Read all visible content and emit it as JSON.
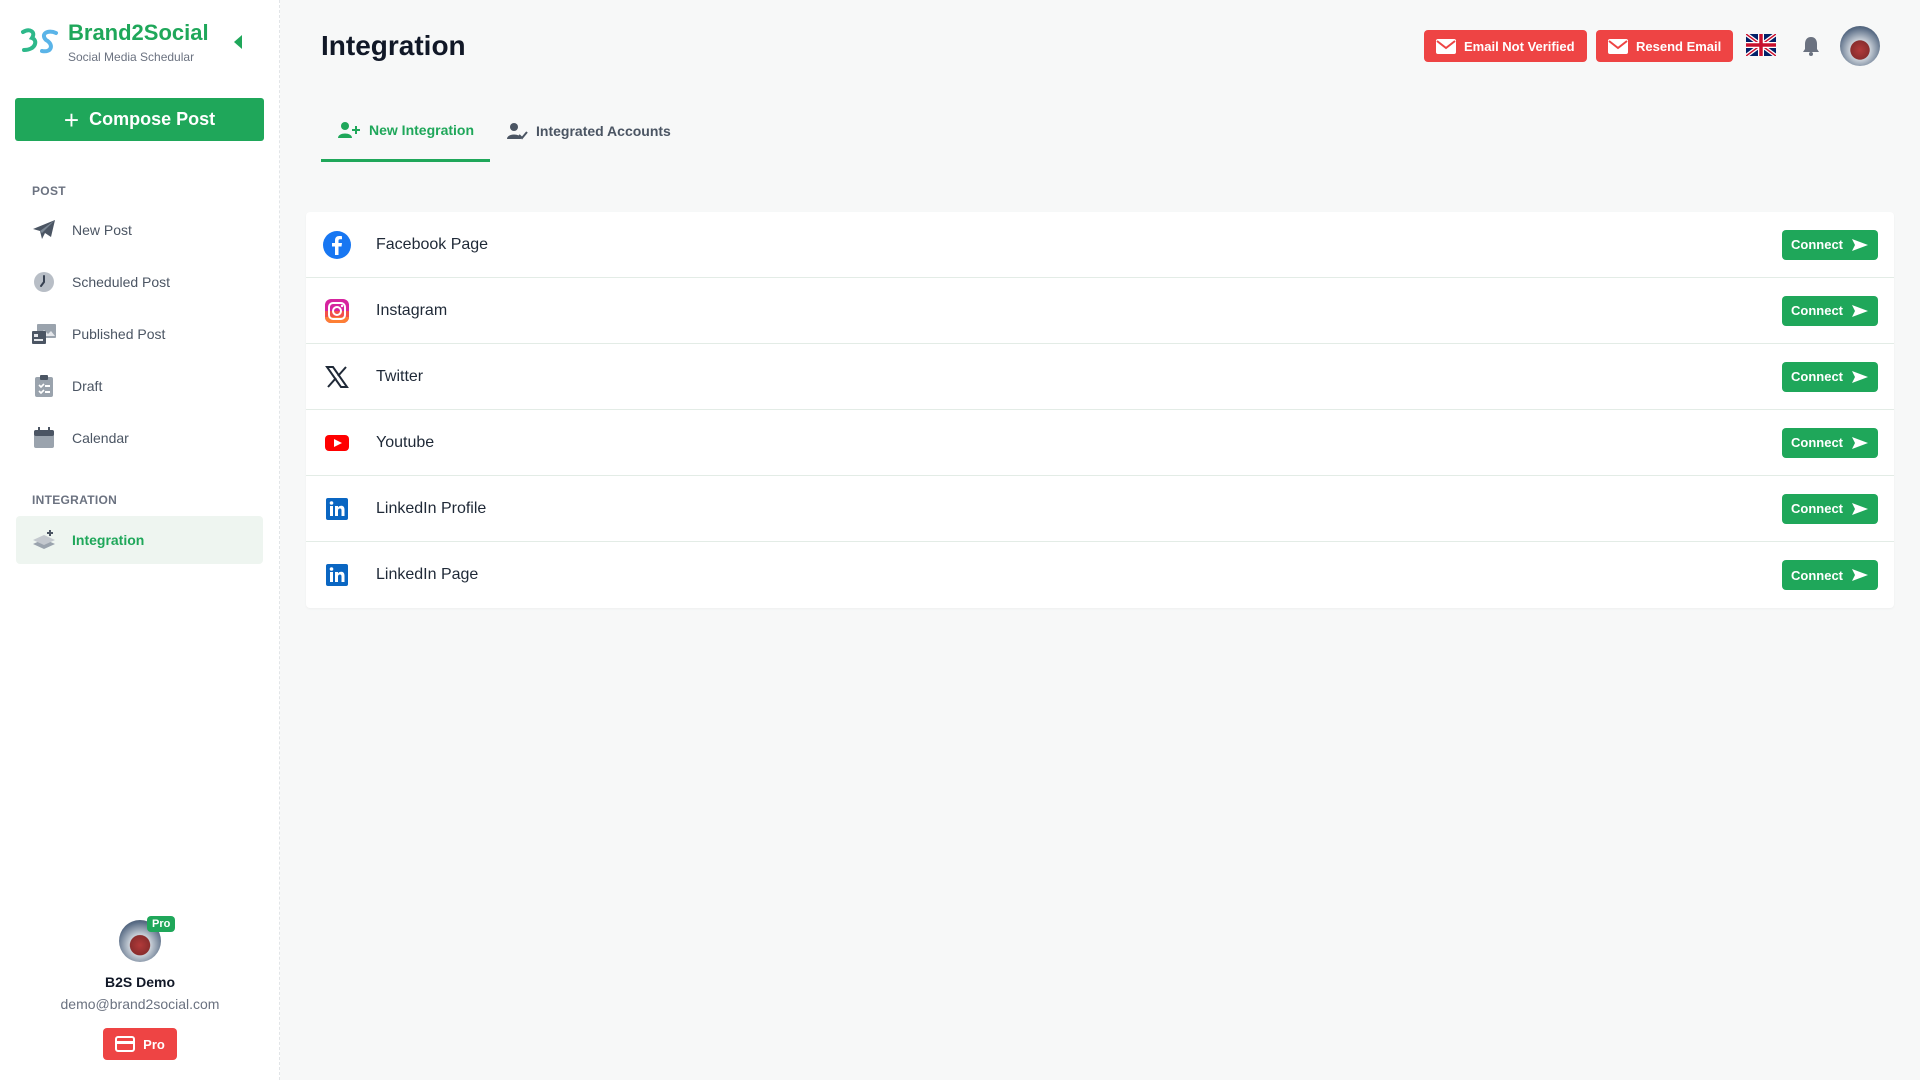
{
  "brand": {
    "name": "Brand2Social",
    "subtitle": "Social Media Schedular"
  },
  "sidebar": {
    "compose_label": "Compose Post",
    "sections": {
      "post": "POST",
      "integration": "INTEGRATION"
    },
    "items": [
      {
        "label": "New Post",
        "icon": "paper-plane-icon"
      },
      {
        "label": "Scheduled Post",
        "icon": "clock-icon"
      },
      {
        "label": "Published Post",
        "icon": "gallery-icon"
      },
      {
        "label": "Draft",
        "icon": "clipboard-icon"
      },
      {
        "label": "Calendar",
        "icon": "calendar-icon"
      },
      {
        "label": "Integration",
        "icon": "layers-icon",
        "active": true
      }
    ]
  },
  "profile": {
    "name": "B2S Demo",
    "email": "demo@brand2social.com",
    "badge": "Pro",
    "plan_button": "Pro"
  },
  "header": {
    "title": "Integration",
    "email_not_verified": "Email Not Verified",
    "resend_email": "Resend Email",
    "language_icon": "uk-flag-icon",
    "notifications_icon": "bell-icon"
  },
  "tabs": [
    {
      "label": "New Integration",
      "active": true
    },
    {
      "label": "Integrated Accounts",
      "active": false
    }
  ],
  "integrations": [
    {
      "label": "Facebook Page",
      "icon": "facebook-icon",
      "action": "Connect"
    },
    {
      "label": "Instagram",
      "icon": "instagram-icon",
      "action": "Connect"
    },
    {
      "label": "Twitter",
      "icon": "x-twitter-icon",
      "action": "Connect"
    },
    {
      "label": "Youtube",
      "icon": "youtube-icon",
      "action": "Connect"
    },
    {
      "label": "LinkedIn Profile",
      "icon": "linkedin-icon",
      "action": "Connect"
    },
    {
      "label": "LinkedIn Page",
      "icon": "linkedin-icon",
      "action": "Connect"
    }
  ],
  "colors": {
    "primary": "#1fa75a",
    "danger": "#ee4444",
    "background": "#f7f8f8"
  }
}
